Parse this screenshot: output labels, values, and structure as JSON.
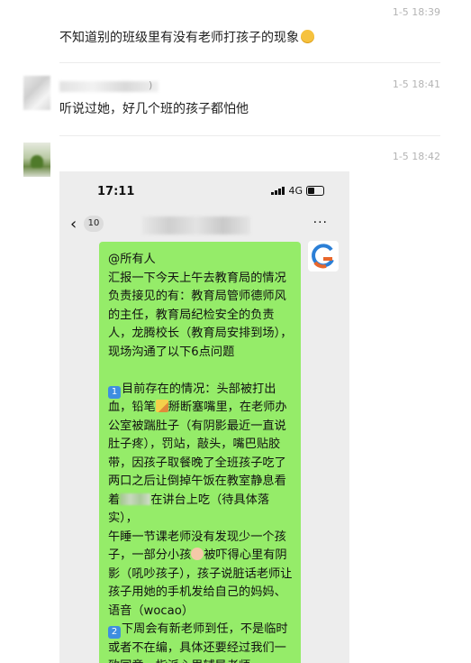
{
  "comments": [
    {
      "time": "1-5 18:39",
      "text": "不知道别的班级里有没有老师打孩子的现象",
      "emoji": "confused-face"
    },
    {
      "time": "1-5 18:41",
      "name_suffix": ")",
      "text": "听说过她，好几个班的孩子都怕他"
    },
    {
      "time": "1-5 18:42"
    }
  ],
  "screenshot": {
    "status_time": "17:11",
    "network": "4G",
    "unread_count": "10",
    "more_label": "···",
    "logo_letter": "G",
    "message": {
      "l1": "@所有人",
      "l2": "汇报一下今天上午去教育局的情况",
      "l3": "负责接见的有：教育局管师德师风的主任，教育局纪检安全的负责人，龙腾校长（教育局安排到场），现场沟通了以下6点问题",
      "k1": "1",
      "l4a": "目前存在的情况：头部被打出血，铅笔",
      "l4b": "掰断塞嘴里，在老师办公室被踹肚子（有阴影最近一直说肚子疼），罚站，敲头，嘴巴贴胶带，因孩子取餐晚了全班孩子吃了两口之后让倒掉午饭在教室静息看着",
      "l4c": "在讲台上吃（待具体落实），",
      "l5a": "午睡一节课老师没有发现少一个孩子，一部分小孩",
      "l5b": "被吓得心里有阴影（吼吵孩子），孩子说脏话老师让孩子用她的手机发给自己的妈妈、语音（wocao）",
      "k2": "2",
      "l6": "下周会有新老师到任，不是临时或者不在编，具体还要经过我们一致同意，指派心里辅导老师"
    }
  },
  "colors": {
    "bubble": "#95ec69",
    "time": "#b4b4b4",
    "keycap": "#3e8ee0"
  }
}
